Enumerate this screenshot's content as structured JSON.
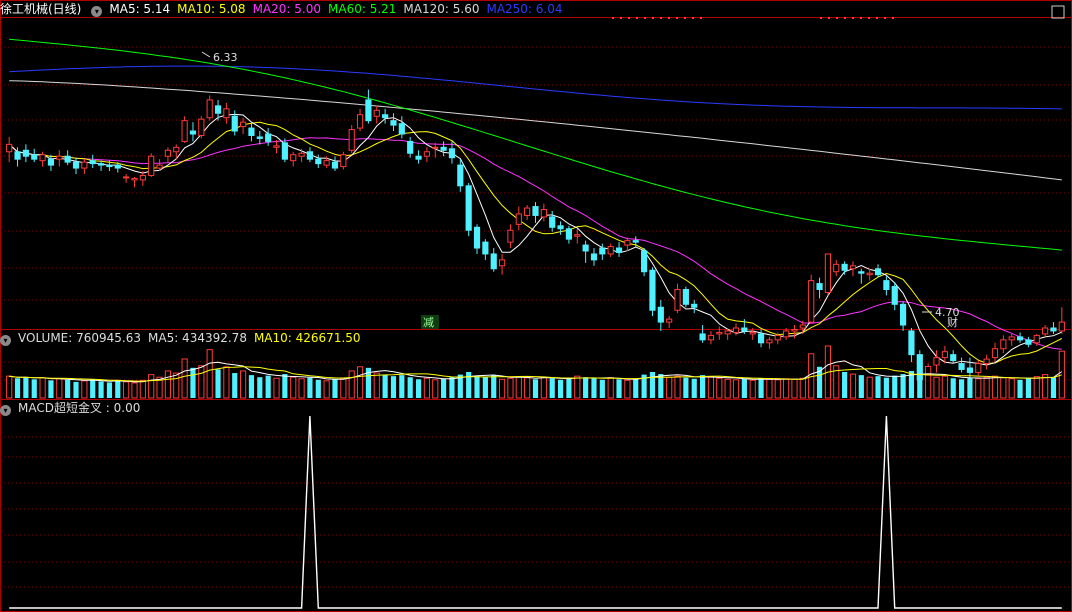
{
  "colors": {
    "background": "#000000",
    "frame": "#b00000",
    "grid": "#7a0000",
    "up": "#ff3b3b",
    "down": "#4ff0ff",
    "ma5": "#ffffff",
    "ma10": "#ffff00",
    "ma20": "#ff33ff",
    "ma60": "#00ff00",
    "ma120": "#d8d8d8",
    "ma250": "#2a3bff",
    "macd": "#ffffff"
  },
  "price_panel": {
    "title": "徐工机械(日线)",
    "settings_icon": "chevron-down-icon",
    "legend": [
      {
        "label": "MA5: 5.14",
        "color": "#ffffff"
      },
      {
        "label": "MA10: 5.08",
        "color": "#ffff00"
      },
      {
        "label": "MA20: 5.00",
        "color": "#ff33ff"
      },
      {
        "label": "MA60: 5.21",
        "color": "#00ff00"
      },
      {
        "label": "MA120: 5.60",
        "color": "#d8d8d8"
      },
      {
        "label": "MA250: 6.04",
        "color": "#2a3bff"
      }
    ],
    "high_marker": "6.33",
    "low_marker": "4.70",
    "signal_reduce": "减",
    "signal_finance": "财"
  },
  "volume_panel": {
    "legend": [
      {
        "label": "VOLUME: 760945.63",
        "color": "#dddddd"
      },
      {
        "label": "MA5: 434392.78",
        "color": "#dddddd"
      },
      {
        "label": "MA10: 426671.50",
        "color": "#ffff00"
      }
    ]
  },
  "macd_panel": {
    "legend": [
      {
        "label": "MACD超短金叉 : 0.00",
        "color": "#dddddd"
      }
    ]
  },
  "chart_data": [
    {
      "type": "candlestick",
      "panel": "price",
      "ylim": [
        4.6,
        6.7
      ],
      "ohlc": [
        [
          5.79,
          5.89,
          5.72,
          5.84
        ],
        [
          5.79,
          5.82,
          5.69,
          5.74
        ],
        [
          5.8,
          5.84,
          5.72,
          5.76
        ],
        [
          5.77,
          5.81,
          5.72,
          5.74
        ],
        [
          5.73,
          5.79,
          5.69,
          5.77
        ],
        [
          5.74,
          5.77,
          5.66,
          5.7
        ],
        [
          5.74,
          5.8,
          5.69,
          5.76
        ],
        [
          5.76,
          5.8,
          5.7,
          5.72
        ],
        [
          5.72,
          5.75,
          5.64,
          5.68
        ],
        [
          5.68,
          5.74,
          5.64,
          5.72
        ],
        [
          5.73,
          5.77,
          5.68,
          5.71
        ],
        [
          5.71,
          5.73,
          5.66,
          5.7
        ],
        [
          5.7,
          5.73,
          5.66,
          5.69
        ],
        [
          5.7,
          5.72,
          5.65,
          5.68
        ],
        [
          5.62,
          5.64,
          5.58,
          5.62
        ],
        [
          5.6,
          5.62,
          5.55,
          5.61
        ],
        [
          5.6,
          5.66,
          5.56,
          5.63
        ],
        [
          5.63,
          5.78,
          5.62,
          5.76
        ],
        [
          5.68,
          5.74,
          5.66,
          5.7
        ],
        [
          5.76,
          5.82,
          5.72,
          5.8
        ],
        [
          5.79,
          5.84,
          5.74,
          5.82
        ],
        [
          5.86,
          6.03,
          5.85,
          6.0
        ],
        [
          5.93,
          5.99,
          5.86,
          5.91
        ],
        [
          5.9,
          6.03,
          5.88,
          6.01
        ],
        [
          6.02,
          6.17,
          6.0,
          6.14
        ],
        [
          6.1,
          6.14,
          6.0,
          6.05
        ],
        [
          6.02,
          6.12,
          5.98,
          6.08
        ],
        [
          6.03,
          6.07,
          5.9,
          5.93
        ],
        [
          5.96,
          6.02,
          5.91,
          5.99
        ],
        [
          5.95,
          5.98,
          5.86,
          5.9
        ],
        [
          5.89,
          5.93,
          5.84,
          5.88
        ],
        [
          5.91,
          5.95,
          5.83,
          5.86
        ],
        [
          5.82,
          5.87,
          5.78,
          5.83
        ],
        [
          5.85,
          5.88,
          5.72,
          5.74
        ],
        [
          5.73,
          5.79,
          5.69,
          5.77
        ],
        [
          5.76,
          5.81,
          5.72,
          5.78
        ],
        [
          5.79,
          5.82,
          5.72,
          5.74
        ],
        [
          5.74,
          5.77,
          5.68,
          5.71
        ],
        [
          5.7,
          5.76,
          5.68,
          5.73
        ],
        [
          5.72,
          5.76,
          5.66,
          5.68
        ],
        [
          5.69,
          5.79,
          5.67,
          5.77
        ],
        [
          5.8,
          5.97,
          5.78,
          5.94
        ],
        [
          5.95,
          6.08,
          5.93,
          6.04
        ],
        [
          6.14,
          6.21,
          5.98,
          6.0
        ],
        [
          6.03,
          6.1,
          5.98,
          6.07
        ],
        [
          6.04,
          6.08,
          5.98,
          6.02
        ],
        [
          6.0,
          6.05,
          5.93,
          5.97
        ],
        [
          5.98,
          6.03,
          5.88,
          5.91
        ],
        [
          5.86,
          5.89,
          5.75,
          5.78
        ],
        [
          5.76,
          5.8,
          5.71,
          5.74
        ],
        [
          5.76,
          5.82,
          5.72,
          5.79
        ],
        [
          5.82,
          5.85,
          5.75,
          5.82
        ],
        [
          5.82,
          5.86,
          5.76,
          5.8
        ],
        [
          5.81,
          5.86,
          5.71,
          5.75
        ],
        [
          5.7,
          5.74,
          5.52,
          5.56
        ],
        [
          5.56,
          5.58,
          5.22,
          5.26
        ],
        [
          5.28,
          5.3,
          5.1,
          5.14
        ],
        [
          5.18,
          5.2,
          5.06,
          5.1
        ],
        [
          5.1,
          5.14,
          4.98,
          5.0
        ],
        [
          5.02,
          5.1,
          4.96,
          5.06
        ],
        [
          5.18,
          5.3,
          5.14,
          5.26
        ],
        [
          5.3,
          5.42,
          5.26,
          5.37
        ],
        [
          5.36,
          5.43,
          5.33,
          5.41
        ],
        [
          5.42,
          5.45,
          5.31,
          5.36
        ],
        [
          5.35,
          5.44,
          5.32,
          5.4
        ],
        [
          5.35,
          5.39,
          5.25,
          5.28
        ],
        [
          5.29,
          5.32,
          5.23,
          5.27
        ],
        [
          5.27,
          5.29,
          5.17,
          5.2
        ],
        [
          5.22,
          5.27,
          5.17,
          5.23
        ],
        [
          5.16,
          5.19,
          5.04,
          5.12
        ],
        [
          5.1,
          5.14,
          5.02,
          5.06
        ],
        [
          5.14,
          5.17,
          5.06,
          5.1
        ],
        [
          5.1,
          5.17,
          5.08,
          5.15
        ],
        [
          5.14,
          5.18,
          5.08,
          5.11
        ],
        [
          5.16,
          5.21,
          5.12,
          5.19
        ],
        [
          5.19,
          5.22,
          5.15,
          5.18
        ],
        [
          5.12,
          5.14,
          4.95,
          4.98
        ],
        [
          4.99,
          5.01,
          4.68,
          4.72
        ],
        [
          4.74,
          4.79,
          4.58,
          4.64
        ],
        [
          4.64,
          4.68,
          4.6,
          4.66
        ],
        [
          4.72,
          4.9,
          4.7,
          4.86
        ],
        [
          4.86,
          4.88,
          4.74,
          4.76
        ],
        [
          4.76,
          4.79,
          4.7,
          4.74
        ],
        [
          4.56,
          4.62,
          4.5,
          4.52
        ],
        [
          4.52,
          4.58,
          4.49,
          4.55
        ],
        [
          4.56,
          4.61,
          4.52,
          4.57
        ],
        [
          4.56,
          4.6,
          4.52,
          4.58
        ],
        [
          4.57,
          4.63,
          4.55,
          4.6
        ],
        [
          4.6,
          4.66,
          4.56,
          4.58
        ],
        [
          4.56,
          4.6,
          4.52,
          4.57
        ],
        [
          4.56,
          4.59,
          4.47,
          4.5
        ],
        [
          4.5,
          4.54,
          4.46,
          4.52
        ],
        [
          4.52,
          4.57,
          4.49,
          4.55
        ],
        [
          4.54,
          4.6,
          4.52,
          4.58
        ],
        [
          4.58,
          4.62,
          4.53,
          4.59
        ],
        [
          4.6,
          4.65,
          4.56,
          4.62
        ],
        [
          4.64,
          4.96,
          4.63,
          4.92
        ],
        [
          4.9,
          4.94,
          4.8,
          4.86
        ],
        [
          4.84,
          4.98,
          4.82,
          5.1
        ],
        [
          4.98,
          5.06,
          4.95,
          5.03
        ],
        [
          5.03,
          5.05,
          4.96,
          4.99
        ],
        [
          5.0,
          5.05,
          4.95,
          5.02
        ],
        [
          4.98,
          5.0,
          4.9,
          4.97
        ],
        [
          4.96,
          5.0,
          4.92,
          4.97
        ],
        [
          5.0,
          5.03,
          4.94,
          4.96
        ],
        [
          4.92,
          4.95,
          4.82,
          4.86
        ],
        [
          4.88,
          4.91,
          4.72,
          4.76
        ],
        [
          4.76,
          4.78,
          4.58,
          4.62
        ],
        [
          4.58,
          4.6,
          4.37,
          4.42
        ],
        [
          4.42,
          4.45,
          4.2,
          4.25
        ],
        [
          4.28,
          4.36,
          4.26,
          4.34
        ],
        [
          4.35,
          4.45,
          4.3,
          4.4
        ],
        [
          4.4,
          4.48,
          4.36,
          4.44
        ],
        [
          4.42,
          4.45,
          4.36,
          4.38
        ],
        [
          4.36,
          4.4,
          4.3,
          4.32
        ],
        [
          4.33,
          4.4,
          4.26,
          4.3
        ],
        [
          4.3,
          4.38,
          4.28,
          4.36
        ],
        [
          4.36,
          4.42,
          4.32,
          4.39
        ],
        [
          4.4,
          4.5,
          4.37,
          4.46
        ],
        [
          4.46,
          4.55,
          4.43,
          4.52
        ],
        [
          4.52,
          4.56,
          4.48,
          4.54
        ],
        [
          4.54,
          4.57,
          4.5,
          4.52
        ],
        [
          4.52,
          4.54,
          4.47,
          4.49
        ],
        [
          4.5,
          4.56,
          4.48,
          4.55
        ],
        [
          4.56,
          4.62,
          4.54,
          4.6
        ],
        [
          4.6,
          4.64,
          4.56,
          4.58
        ],
        [
          4.58,
          4.74,
          4.56,
          4.64
        ]
      ]
    },
    {
      "type": "bar",
      "panel": "volume",
      "values": [
        0.42,
        0.38,
        0.4,
        0.36,
        0.39,
        0.34,
        0.37,
        0.35,
        0.31,
        0.33,
        0.36,
        0.32,
        0.3,
        0.33,
        0.31,
        0.29,
        0.34,
        0.45,
        0.4,
        0.52,
        0.48,
        0.75,
        0.58,
        0.62,
        0.93,
        0.55,
        0.6,
        0.48,
        0.52,
        0.44,
        0.4,
        0.43,
        0.38,
        0.46,
        0.4,
        0.37,
        0.39,
        0.35,
        0.33,
        0.36,
        0.38,
        0.52,
        0.6,
        0.58,
        0.48,
        0.45,
        0.42,
        0.44,
        0.4,
        0.36,
        0.38,
        0.35,
        0.37,
        0.4,
        0.45,
        0.5,
        0.42,
        0.4,
        0.44,
        0.36,
        0.38,
        0.41,
        0.39,
        0.36,
        0.4,
        0.38,
        0.35,
        0.37,
        0.42,
        0.4,
        0.38,
        0.35,
        0.39,
        0.36,
        0.34,
        0.37,
        0.45,
        0.5,
        0.46,
        0.4,
        0.42,
        0.39,
        0.37,
        0.44,
        0.4,
        0.38,
        0.36,
        0.35,
        0.37,
        0.34,
        0.38,
        0.36,
        0.35,
        0.37,
        0.36,
        0.38,
        0.85,
        0.6,
        1.0,
        0.62,
        0.5,
        0.46,
        0.44,
        0.4,
        0.42,
        0.39,
        0.43,
        0.46,
        0.52,
        0.48,
        0.44,
        0.4,
        0.42,
        0.38,
        0.36,
        0.39,
        0.37,
        0.4,
        0.42,
        0.39,
        0.37,
        0.35,
        0.38,
        0.41,
        0.45,
        0.4,
        0.9
      ]
    },
    {
      "type": "line",
      "panel": "macd",
      "name": "MACD超短金叉",
      "ylim": [
        0,
        1
      ],
      "spike_indices": [
        36,
        105
      ],
      "last_value": 0.0
    }
  ]
}
